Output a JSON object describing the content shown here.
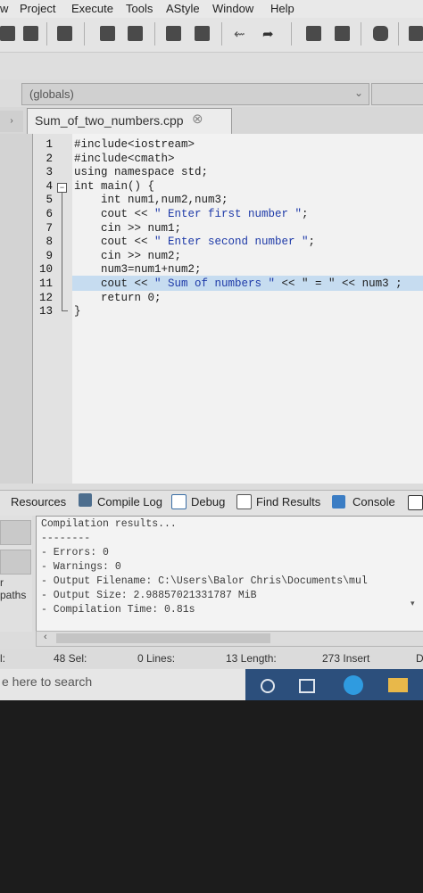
{
  "menu": [
    "w",
    "Project",
    "Execute",
    "Tools",
    "AStyle",
    "Window",
    "Help"
  ],
  "scope_combo": {
    "value": "(globals)"
  },
  "file_tab": {
    "label": "Sum_of_two_numbers.cpp",
    "close": "⊗"
  },
  "line_numbers": [
    "1",
    "2",
    "3",
    "4",
    "5",
    "6",
    "7",
    "8",
    "9",
    "10",
    "11",
    "12",
    "13"
  ],
  "code_lines": [
    {
      "pre": "#include<iostream>",
      "str": "",
      "post": ""
    },
    {
      "pre": "#include<cmath>",
      "str": "",
      "post": ""
    },
    {
      "pre": "using namespace std;",
      "str": "",
      "post": ""
    },
    {
      "pre": "int main() {",
      "str": "",
      "post": ""
    },
    {
      "pre": "    int num1,num2,num3;",
      "str": "",
      "post": ""
    },
    {
      "pre": "    cout << ",
      "str": "\" Enter first number \"",
      "post": ";"
    },
    {
      "pre": "    cin >> num1;",
      "str": "",
      "post": ""
    },
    {
      "pre": "    cout << ",
      "str": "\" Enter second number \"",
      "post": ";"
    },
    {
      "pre": "    cin >> num2;",
      "str": "",
      "post": ""
    },
    {
      "pre": "    num3=num1+num2;",
      "str": "",
      "post": ""
    },
    {
      "pre": "    cout << ",
      "str": "\" Sum of numbers \"",
      "post": " << \" = \" << num3 ;"
    },
    {
      "pre": "    return 0;",
      "str": "",
      "post": ""
    },
    {
      "pre": "}",
      "str": "",
      "post": ""
    }
  ],
  "highlighted_line": 11,
  "bottom_tabs": [
    "Resources",
    "Compile Log",
    "Debug",
    "Find Results",
    "Console"
  ],
  "left_panel": {
    "paths_label": "r paths"
  },
  "compile_output": [
    "Compilation results...",
    "--------",
    "- Errors: 0",
    "- Warnings: 0",
    "- Output Filename: C:\\Users\\Balor Chris\\Documents\\mul",
    "- Output Size: 2.98857021331787 MiB",
    "- Compilation Time: 0.81s"
  ],
  "status_bar": {
    "line_label": "l:",
    "sel": "48 Sel:",
    "lines": "0 Lines:",
    "length": "13 Length:",
    "insert": "273 Insert",
    "extra": "D"
  },
  "taskbar": {
    "search_placeholder": "e here to search"
  },
  "colors": {
    "highlight": "#c6dcf0",
    "string": "#1e3aa8",
    "taskbar": "#2c4f7c"
  }
}
